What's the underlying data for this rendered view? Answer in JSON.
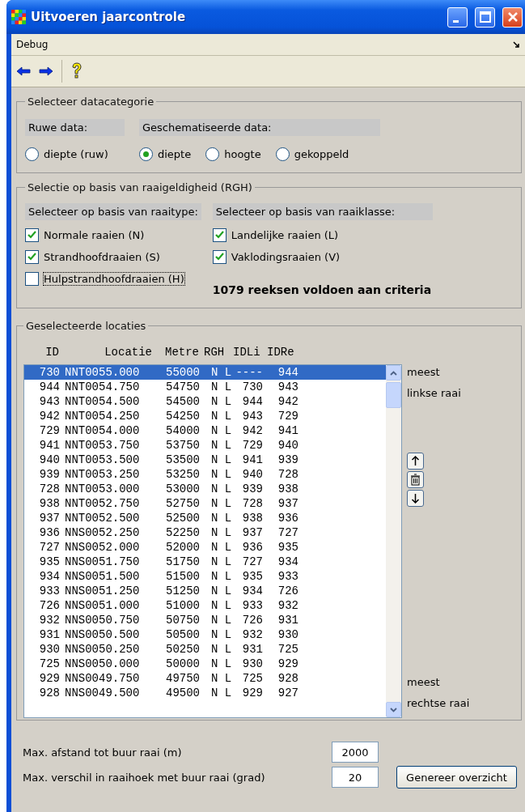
{
  "window": {
    "title": "Uitvoeren jaarcontrole"
  },
  "menu": [
    "Debug"
  ],
  "datacategorie": {
    "title": "Selecteer datacategorie",
    "groups": [
      {
        "label": "Ruwe data:",
        "options": [
          {
            "label": "diepte (ruw)",
            "selected": false
          }
        ]
      },
      {
        "label": "Geschematiseerde data:",
        "options": [
          {
            "label": "diepte",
            "selected": true
          },
          {
            "label": "hoogte",
            "selected": false
          },
          {
            "label": "gekoppeld",
            "selected": false
          }
        ]
      }
    ]
  },
  "rgh": {
    "title": "Selectie op basis van raaigeldigheid (RGH)",
    "columns": [
      {
        "label": "Selecteer op basis van raaitype:",
        "items": [
          {
            "label": "Normale raaien (N)",
            "checked": true,
            "focused": false
          },
          {
            "label": "Strandhoofdraaien (S)",
            "checked": true,
            "focused": false
          },
          {
            "label": "Hulpstrandhoofdraaien (H)",
            "checked": false,
            "focused": true
          }
        ]
      },
      {
        "label": "Selecteer op basis van raaiklasse:",
        "items": [
          {
            "label": "Landelijke raaien (L)",
            "checked": true,
            "focused": false
          },
          {
            "label": "Vaklodingsraaien (V)",
            "checked": true,
            "focused": false
          }
        ]
      }
    ],
    "summary": "1079 reeksen voldoen aan criteria"
  },
  "locaties": {
    "title": "Geselecteerde locaties",
    "columns": [
      "ID",
      "Locatie",
      "Metre",
      "RGH",
      "IDLi",
      "IDRe"
    ],
    "rows": [
      {
        "id": "730",
        "locatie": "NNT0055.000",
        "metre": "55000",
        "rgh": "N L",
        "idli": "----",
        "idre": "944",
        "selected": true
      },
      {
        "id": "944",
        "locatie": "NNT0054.750",
        "metre": "54750",
        "rgh": "N L",
        "idli": "730",
        "idre": "943",
        "selected": false
      },
      {
        "id": "943",
        "locatie": "NNT0054.500",
        "metre": "54500",
        "rgh": "N L",
        "idli": "944",
        "idre": "942",
        "selected": false
      },
      {
        "id": "942",
        "locatie": "NNT0054.250",
        "metre": "54250",
        "rgh": "N L",
        "idli": "943",
        "idre": "729",
        "selected": false
      },
      {
        "id": "729",
        "locatie": "NNT0054.000",
        "metre": "54000",
        "rgh": "N L",
        "idli": "942",
        "idre": "941",
        "selected": false
      },
      {
        "id": "941",
        "locatie": "NNT0053.750",
        "metre": "53750",
        "rgh": "N L",
        "idli": "729",
        "idre": "940",
        "selected": false
      },
      {
        "id": "940",
        "locatie": "NNT0053.500",
        "metre": "53500",
        "rgh": "N L",
        "idli": "941",
        "idre": "939",
        "selected": false
      },
      {
        "id": "939",
        "locatie": "NNT0053.250",
        "metre": "53250",
        "rgh": "N L",
        "idli": "940",
        "idre": "728",
        "selected": false
      },
      {
        "id": "728",
        "locatie": "NNT0053.000",
        "metre": "53000",
        "rgh": "N L",
        "idli": "939",
        "idre": "938",
        "selected": false
      },
      {
        "id": "938",
        "locatie": "NNT0052.750",
        "metre": "52750",
        "rgh": "N L",
        "idli": "728",
        "idre": "937",
        "selected": false
      },
      {
        "id": "937",
        "locatie": "NNT0052.500",
        "metre": "52500",
        "rgh": "N L",
        "idli": "938",
        "idre": "936",
        "selected": false
      },
      {
        "id": "936",
        "locatie": "NNS0052.250",
        "metre": "52250",
        "rgh": "N L",
        "idli": "937",
        "idre": "727",
        "selected": false
      },
      {
        "id": "727",
        "locatie": "NNS0052.000",
        "metre": "52000",
        "rgh": "N L",
        "idli": "936",
        "idre": "935",
        "selected": false
      },
      {
        "id": "935",
        "locatie": "NNS0051.750",
        "metre": "51750",
        "rgh": "N L",
        "idli": "727",
        "idre": "934",
        "selected": false
      },
      {
        "id": "934",
        "locatie": "NNS0051.500",
        "metre": "51500",
        "rgh": "N L",
        "idli": "935",
        "idre": "933",
        "selected": false
      },
      {
        "id": "933",
        "locatie": "NNS0051.250",
        "metre": "51250",
        "rgh": "N L",
        "idli": "934",
        "idre": "726",
        "selected": false
      },
      {
        "id": "726",
        "locatie": "NNS0051.000",
        "metre": "51000",
        "rgh": "N L",
        "idli": "933",
        "idre": "932",
        "selected": false
      },
      {
        "id": "932",
        "locatie": "NNS0050.750",
        "metre": "50750",
        "rgh": "N L",
        "idli": "726",
        "idre": "931",
        "selected": false
      },
      {
        "id": "931",
        "locatie": "NNS0050.500",
        "metre": "50500",
        "rgh": "N L",
        "idli": "932",
        "idre": "930",
        "selected": false
      },
      {
        "id": "930",
        "locatie": "NNS0050.250",
        "metre": "50250",
        "rgh": "N L",
        "idli": "931",
        "idre": "725",
        "selected": false
      },
      {
        "id": "725",
        "locatie": "NNS0050.000",
        "metre": "50000",
        "rgh": "N L",
        "idli": "930",
        "idre": "929",
        "selected": false
      },
      {
        "id": "929",
        "locatie": "NNS0049.750",
        "metre": "49750",
        "rgh": "N L",
        "idli": "725",
        "idre": "928",
        "selected": false
      },
      {
        "id": "928",
        "locatie": "NNS0049.500",
        "metre": "49500",
        "rgh": "N L",
        "idli": "929",
        "idre": "927",
        "selected": false
      }
    ],
    "top_label": [
      "meest",
      "linkse raai"
    ],
    "bottom_label": [
      "meest",
      "rechtse raai"
    ]
  },
  "params": [
    {
      "label": "Max. afstand tot buur raai (m)",
      "value": "2000"
    },
    {
      "label": "Max. verschil in raaihoek met buur raai (grad)",
      "value": "20"
    }
  ],
  "generate_button": "Genereer overzicht"
}
